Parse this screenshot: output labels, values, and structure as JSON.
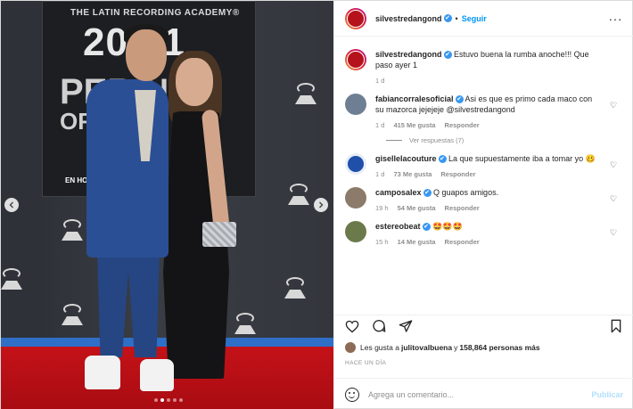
{
  "photo": {
    "academy_text": "THE LATIN RECORDING ACADEMY®",
    "year_text": "20 21",
    "backdrop_line1": "PER  N",
    "backdrop_line2": "OF   D",
    "backdrop_line3": "T",
    "backdrop_line4": "EN HO",
    "carousel_dots": 5,
    "active_dot": 1
  },
  "header": {
    "username": "silvestredangond",
    "verified": "✔",
    "separator": "•",
    "follow_label": "Seguir",
    "more_label": "···"
  },
  "caption": {
    "username": "silvestredangond",
    "text": " Estuvo buena la rumba anoche!!! Que paso ayer 1",
    "time": "1 d"
  },
  "comments": [
    {
      "username": "fabiancorralesoficial",
      "text": " Asi es que es primo cada maco con su mazorca jejejeje @silvestredangond",
      "time": "1 d",
      "likes": "415 Me gusta",
      "reply": "Responder",
      "verified": true,
      "avatar_color": "#6f7f93",
      "view_replies": "Ver respuestas (7)"
    },
    {
      "username": "gisellelacouture",
      "text": " La que supuestamente iba a tomar yo 🥴",
      "time": "1 d",
      "likes": "73 Me gusta",
      "reply": "Responder",
      "verified": true,
      "avatar_color": "#1f4fa8"
    },
    {
      "username": "camposalex",
      "text": " Q guapos amigos.",
      "time": "19 h",
      "likes": "54 Me gusta",
      "reply": "Responder",
      "verified": true,
      "avatar_color": "#8c7a6a"
    },
    {
      "username": "estereobeat",
      "text": " 🤩🤩🤩",
      "time": "15 h",
      "likes": "14 Me gusta",
      "reply": "Responder",
      "verified": true,
      "avatar_color": "#6b7a4a"
    }
  ],
  "actions": {
    "likes_prefix": "Les gusta a ",
    "likes_user": "julitovalbuena",
    "likes_mid": " y ",
    "likes_count": "158,864 personas más",
    "ago": "HACE UN DÍA"
  },
  "add_comment": {
    "placeholder": "Agrega un comentario...",
    "publish_label": "Publicar"
  },
  "colors": {
    "accent": "#0095f6",
    "verified": "#3897f0",
    "muted": "#8e8e8e"
  }
}
